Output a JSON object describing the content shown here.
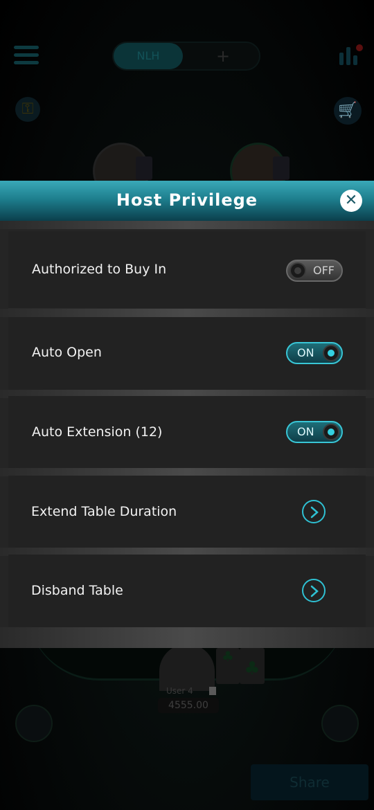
{
  "background": {
    "game_tabs": {
      "active": "NLH",
      "add": "+"
    },
    "player": {
      "name": "User 4",
      "chips": "4555.00"
    },
    "share_label": "Share"
  },
  "dialog": {
    "title": "Host Privilege",
    "close_icon": "close-icon",
    "rows": [
      {
        "label": "Authorized to Buy In",
        "control": "toggle",
        "state": "OFF"
      },
      {
        "label": "Auto Open",
        "control": "toggle",
        "state": "ON"
      },
      {
        "label": "Auto Extension (12)",
        "control": "toggle",
        "state": "ON"
      },
      {
        "label": "Extend Table Duration",
        "control": "arrow",
        "icon": "chevron-right-icon"
      },
      {
        "label": "Disband Table",
        "control": "arrow",
        "icon": "chevron-right-icon"
      }
    ]
  },
  "colors": {
    "accent": "#35d0e0",
    "header": "#1e7f8e",
    "panel": "#222222"
  }
}
